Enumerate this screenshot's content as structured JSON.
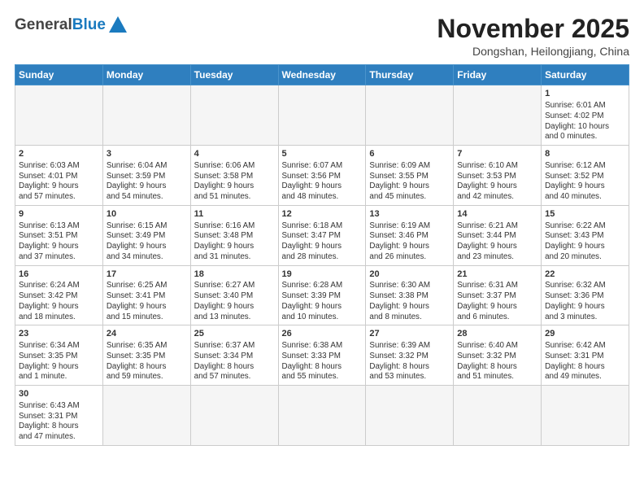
{
  "logo": {
    "word1": "General",
    "word2": "Blue"
  },
  "title": "November 2025",
  "location": "Dongshan, Heilongjiang, China",
  "weekdays": [
    "Sunday",
    "Monday",
    "Tuesday",
    "Wednesday",
    "Thursday",
    "Friday",
    "Saturday"
  ],
  "weeks": [
    [
      {
        "day": "",
        "info": ""
      },
      {
        "day": "",
        "info": ""
      },
      {
        "day": "",
        "info": ""
      },
      {
        "day": "",
        "info": ""
      },
      {
        "day": "",
        "info": ""
      },
      {
        "day": "",
        "info": ""
      },
      {
        "day": "1",
        "info": "Sunrise: 6:01 AM\nSunset: 4:02 PM\nDaylight: 10 hours\nand 0 minutes."
      }
    ],
    [
      {
        "day": "2",
        "info": "Sunrise: 6:03 AM\nSunset: 4:01 PM\nDaylight: 9 hours\nand 57 minutes."
      },
      {
        "day": "3",
        "info": "Sunrise: 6:04 AM\nSunset: 3:59 PM\nDaylight: 9 hours\nand 54 minutes."
      },
      {
        "day": "4",
        "info": "Sunrise: 6:06 AM\nSunset: 3:58 PM\nDaylight: 9 hours\nand 51 minutes."
      },
      {
        "day": "5",
        "info": "Sunrise: 6:07 AM\nSunset: 3:56 PM\nDaylight: 9 hours\nand 48 minutes."
      },
      {
        "day": "6",
        "info": "Sunrise: 6:09 AM\nSunset: 3:55 PM\nDaylight: 9 hours\nand 45 minutes."
      },
      {
        "day": "7",
        "info": "Sunrise: 6:10 AM\nSunset: 3:53 PM\nDaylight: 9 hours\nand 42 minutes."
      },
      {
        "day": "8",
        "info": "Sunrise: 6:12 AM\nSunset: 3:52 PM\nDaylight: 9 hours\nand 40 minutes."
      }
    ],
    [
      {
        "day": "9",
        "info": "Sunrise: 6:13 AM\nSunset: 3:51 PM\nDaylight: 9 hours\nand 37 minutes."
      },
      {
        "day": "10",
        "info": "Sunrise: 6:15 AM\nSunset: 3:49 PM\nDaylight: 9 hours\nand 34 minutes."
      },
      {
        "day": "11",
        "info": "Sunrise: 6:16 AM\nSunset: 3:48 PM\nDaylight: 9 hours\nand 31 minutes."
      },
      {
        "day": "12",
        "info": "Sunrise: 6:18 AM\nSunset: 3:47 PM\nDaylight: 9 hours\nand 28 minutes."
      },
      {
        "day": "13",
        "info": "Sunrise: 6:19 AM\nSunset: 3:46 PM\nDaylight: 9 hours\nand 26 minutes."
      },
      {
        "day": "14",
        "info": "Sunrise: 6:21 AM\nSunset: 3:44 PM\nDaylight: 9 hours\nand 23 minutes."
      },
      {
        "day": "15",
        "info": "Sunrise: 6:22 AM\nSunset: 3:43 PM\nDaylight: 9 hours\nand 20 minutes."
      }
    ],
    [
      {
        "day": "16",
        "info": "Sunrise: 6:24 AM\nSunset: 3:42 PM\nDaylight: 9 hours\nand 18 minutes."
      },
      {
        "day": "17",
        "info": "Sunrise: 6:25 AM\nSunset: 3:41 PM\nDaylight: 9 hours\nand 15 minutes."
      },
      {
        "day": "18",
        "info": "Sunrise: 6:27 AM\nSunset: 3:40 PM\nDaylight: 9 hours\nand 13 minutes."
      },
      {
        "day": "19",
        "info": "Sunrise: 6:28 AM\nSunset: 3:39 PM\nDaylight: 9 hours\nand 10 minutes."
      },
      {
        "day": "20",
        "info": "Sunrise: 6:30 AM\nSunset: 3:38 PM\nDaylight: 9 hours\nand 8 minutes."
      },
      {
        "day": "21",
        "info": "Sunrise: 6:31 AM\nSunset: 3:37 PM\nDaylight: 9 hours\nand 6 minutes."
      },
      {
        "day": "22",
        "info": "Sunrise: 6:32 AM\nSunset: 3:36 PM\nDaylight: 9 hours\nand 3 minutes."
      }
    ],
    [
      {
        "day": "23",
        "info": "Sunrise: 6:34 AM\nSunset: 3:35 PM\nDaylight: 9 hours\nand 1 minute."
      },
      {
        "day": "24",
        "info": "Sunrise: 6:35 AM\nSunset: 3:35 PM\nDaylight: 8 hours\nand 59 minutes."
      },
      {
        "day": "25",
        "info": "Sunrise: 6:37 AM\nSunset: 3:34 PM\nDaylight: 8 hours\nand 57 minutes."
      },
      {
        "day": "26",
        "info": "Sunrise: 6:38 AM\nSunset: 3:33 PM\nDaylight: 8 hours\nand 55 minutes."
      },
      {
        "day": "27",
        "info": "Sunrise: 6:39 AM\nSunset: 3:32 PM\nDaylight: 8 hours\nand 53 minutes."
      },
      {
        "day": "28",
        "info": "Sunrise: 6:40 AM\nSunset: 3:32 PM\nDaylight: 8 hours\nand 51 minutes."
      },
      {
        "day": "29",
        "info": "Sunrise: 6:42 AM\nSunset: 3:31 PM\nDaylight: 8 hours\nand 49 minutes."
      }
    ],
    [
      {
        "day": "30",
        "info": "Sunrise: 6:43 AM\nSunset: 3:31 PM\nDaylight: 8 hours\nand 47 minutes."
      },
      {
        "day": "",
        "info": ""
      },
      {
        "day": "",
        "info": ""
      },
      {
        "day": "",
        "info": ""
      },
      {
        "day": "",
        "info": ""
      },
      {
        "day": "",
        "info": ""
      },
      {
        "day": "",
        "info": ""
      }
    ]
  ]
}
